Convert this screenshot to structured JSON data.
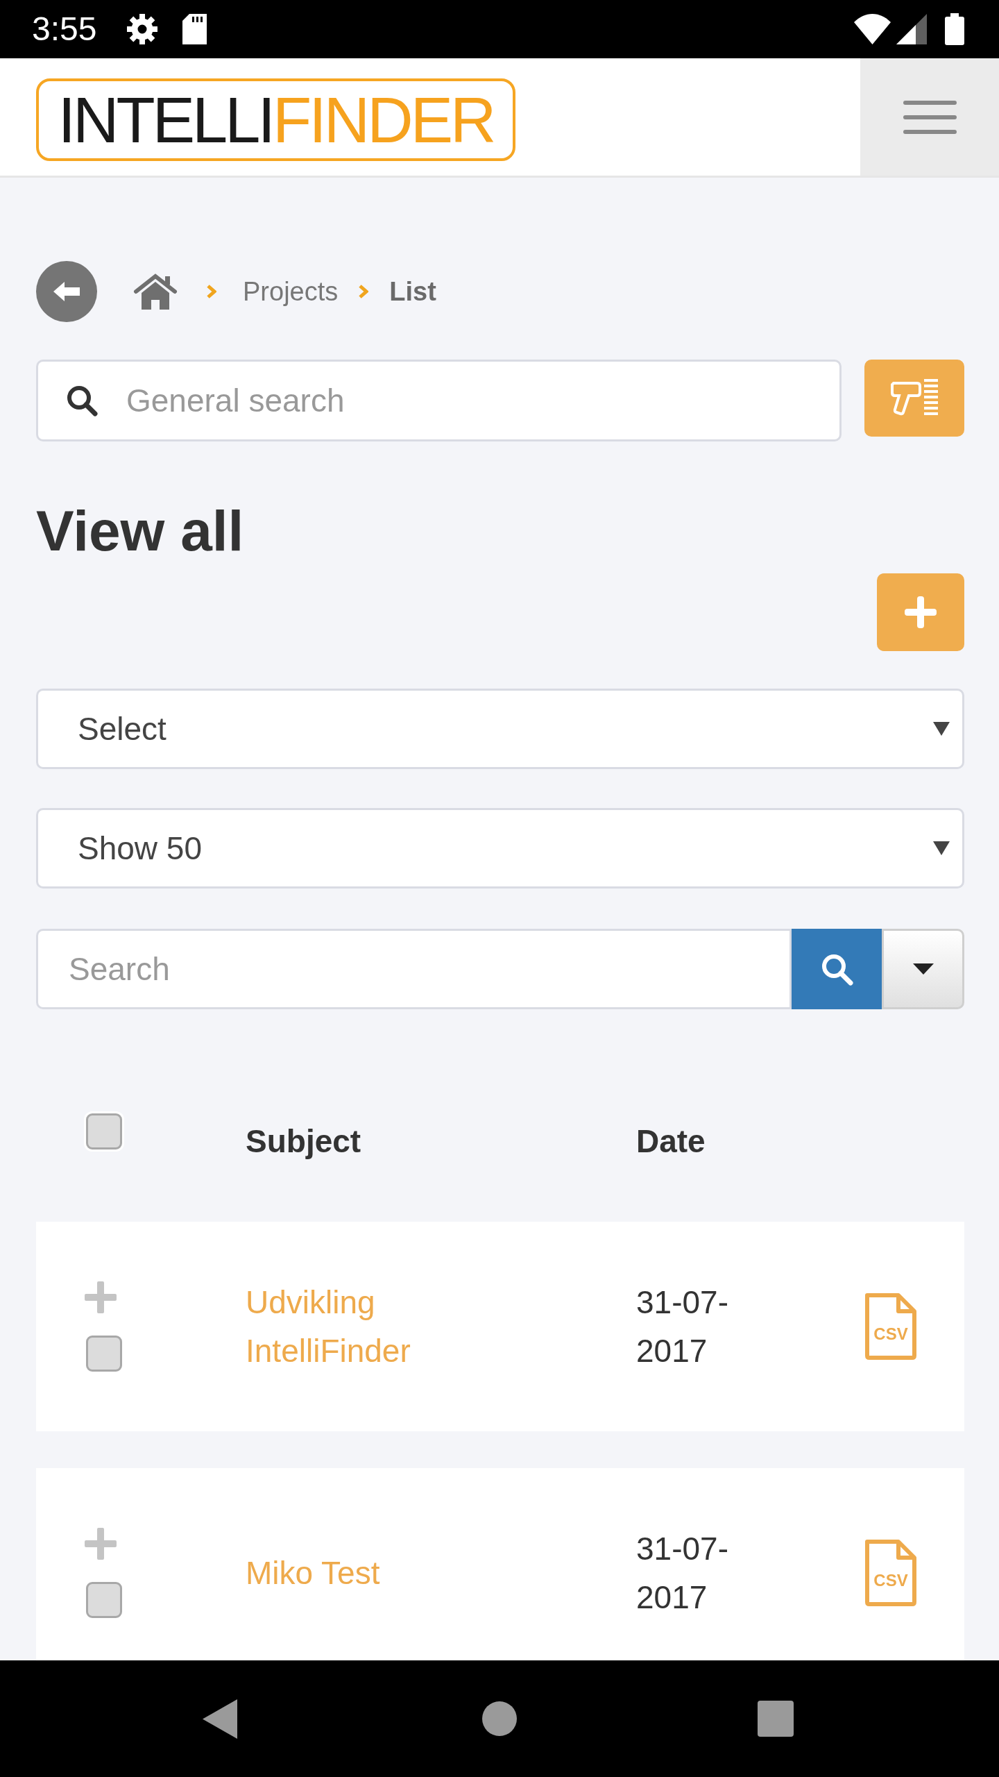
{
  "status_bar": {
    "time": "3:55"
  },
  "header": {
    "logo": {
      "dark_part": "INTELLI",
      "accent_part": "FINDER"
    }
  },
  "breadcrumb": [
    {
      "label": "Projects",
      "current": false
    },
    {
      "label": "List",
      "current": true
    }
  ],
  "general_search": {
    "placeholder": "General search"
  },
  "title": "View all",
  "filters": [
    {
      "kind": "select",
      "value": "Select"
    },
    {
      "kind": "select",
      "value": "Show 50"
    }
  ],
  "table_search": {
    "placeholder": "Search"
  },
  "table": {
    "select_all": {
      "checked": false
    },
    "columns": [
      "Subject",
      "Date"
    ],
    "rows": [
      {
        "subject": "Udvikling IntelliFinder",
        "date": "31-07-2017",
        "checked": false,
        "export_label": "CSV"
      },
      {
        "subject": "Miko Test",
        "date": "31-07-2017",
        "checked": false,
        "export_label": "CSV"
      }
    ]
  }
}
